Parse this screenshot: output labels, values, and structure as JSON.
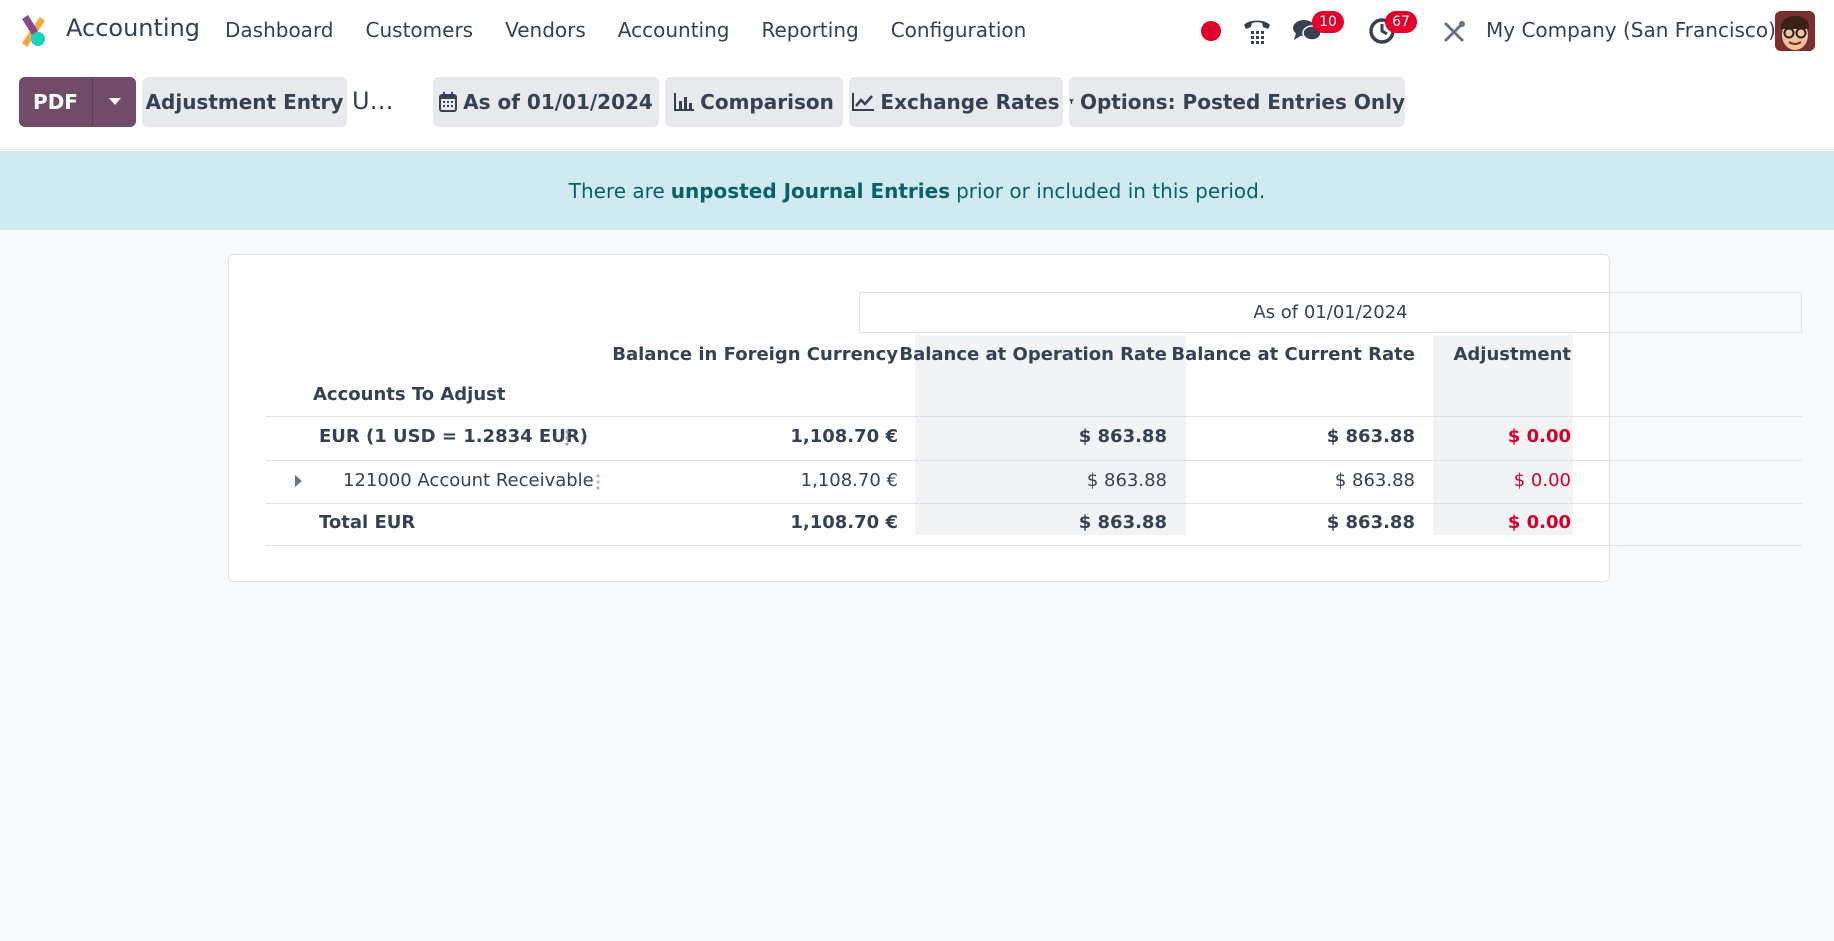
{
  "navbar": {
    "app_name": "Accounting",
    "menu": [
      "Dashboard",
      "Customers",
      "Vendors",
      "Accounting",
      "Reporting",
      "Configuration"
    ],
    "messages_count": "10",
    "activities_count": "67",
    "company": "My Company (San Francisco)",
    "icons": [
      "recording-dot-icon",
      "phone-icon",
      "chat-icon",
      "clock-icon",
      "tools-icon"
    ]
  },
  "controls": {
    "pdf_label": "PDF",
    "adjustment_entry_label": "Adjustment Entry",
    "truncated_label": "U…",
    "date_label": "As of 01/01/2024",
    "comparison_label": "Comparison",
    "exchange_rates_label": "Exchange Rates",
    "options_label": "Options: Posted Entries Only"
  },
  "alert": {
    "prefix": "There are",
    "link": "unposted Journal Entries",
    "suffix": "prior or included in this period."
  },
  "report": {
    "period_header": "As of 01/01/2024",
    "row_header": "Accounts To Adjust",
    "columns": [
      "Balance in Foreign Currency",
      "Balance at Operation Rate",
      "Balance at Current Rate",
      "Adjustment"
    ],
    "rows": [
      {
        "label": "EUR (1 USD = 1.2834 EUR)",
        "values": [
          "1,108.70 €",
          "$ 863.88",
          "$ 863.88",
          "$ 0.00"
        ]
      },
      {
        "label": "121000 Account Receivable",
        "values": [
          "1,108.70 €",
          "$ 863.88",
          "$ 863.88",
          "$ 0.00"
        ]
      },
      {
        "label": "Total EUR",
        "values": [
          "1,108.70 €",
          "$ 863.88",
          "$ 863.88",
          "$ 0.00"
        ]
      }
    ]
  },
  "colors": {
    "brand": "#714b67",
    "alert_bg": "#d0ebf0",
    "alert_text": "#08606b",
    "negative_red": "#d4002b",
    "badge_red": "#e1002b"
  }
}
